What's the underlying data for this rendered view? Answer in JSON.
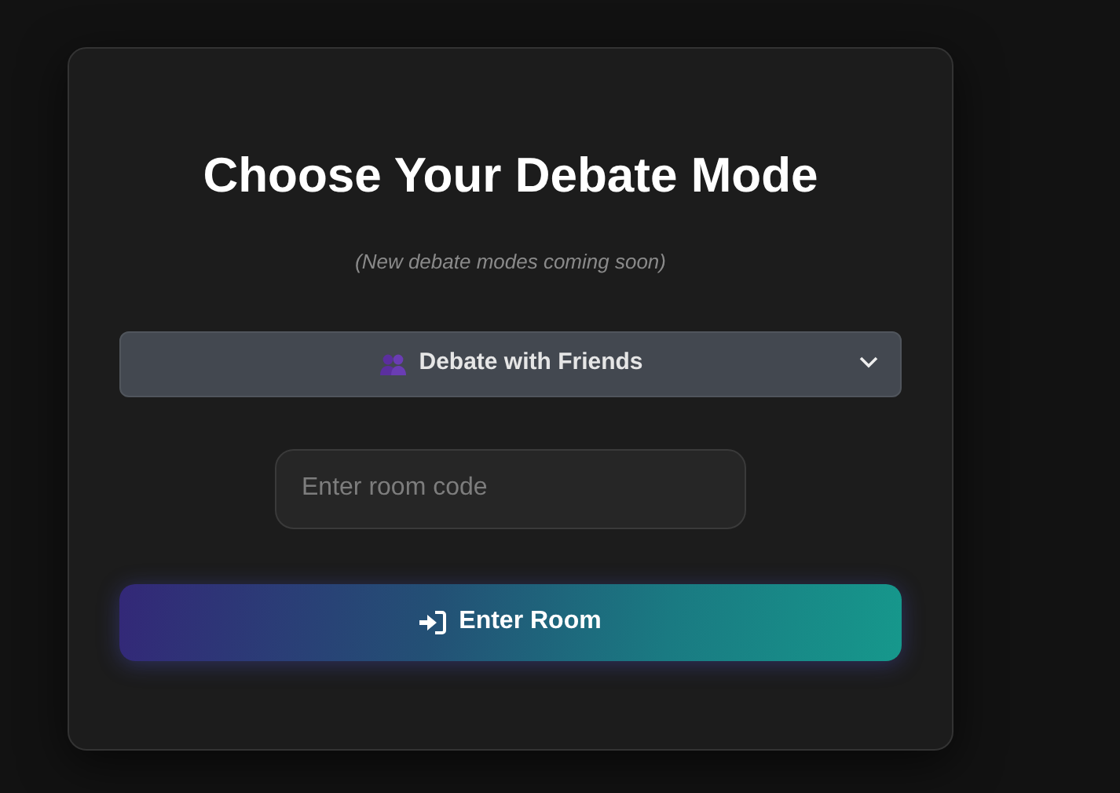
{
  "title": "Choose Your Debate Mode",
  "subtitle": "(New debate modes coming soon)",
  "mode_select": {
    "value": "Debate with Friends"
  },
  "room_code": {
    "placeholder": "Enter room code"
  },
  "button": {
    "label": "Enter Room"
  }
}
